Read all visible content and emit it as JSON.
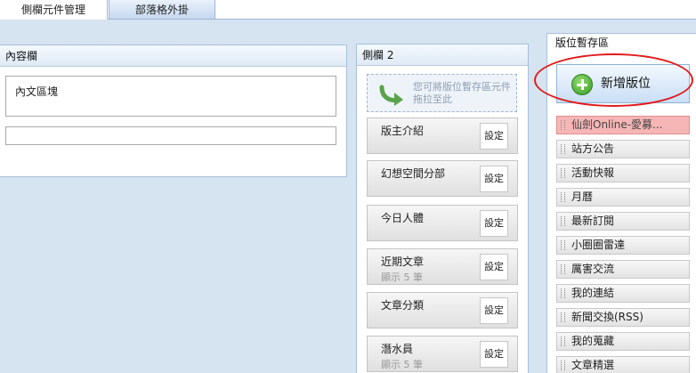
{
  "tabs": [
    {
      "label": "側欄元件管理",
      "active": true
    },
    {
      "label": "部落格外掛",
      "active": false
    }
  ],
  "content_panel": {
    "title": "內容欄",
    "text_block": "內文區塊",
    "text_field_value": ""
  },
  "sidebar2": {
    "title": "側欄 2",
    "drop_hint": "您可將版位暫存區元件拖拉至此",
    "settings_label": "設定",
    "widgets": [
      {
        "title": "版主介紹",
        "subtitle": ""
      },
      {
        "title": "幻想空間分部",
        "subtitle": ""
      },
      {
        "title": "今日人體",
        "subtitle": ""
      },
      {
        "title": "近期文章",
        "subtitle": "顯示 5 筆"
      },
      {
        "title": "文章分類",
        "subtitle": ""
      },
      {
        "title": "潛水員",
        "subtitle": "顯示 5 筆"
      }
    ]
  },
  "storage": {
    "title": "版位暫存區",
    "add_button_label": "新增版位",
    "items": [
      {
        "label": "仙劍Online-愛募...",
        "highlight": true
      },
      {
        "label": "站方公告"
      },
      {
        "label": "活動快報"
      },
      {
        "label": "月曆"
      },
      {
        "label": "最新訂閱"
      },
      {
        "label": "小圈圈雷達"
      },
      {
        "label": "厲害交流"
      },
      {
        "label": "我的連結"
      },
      {
        "label": "新聞交換(RSS)"
      },
      {
        "label": "我的蒐藏"
      },
      {
        "label": "文章精選"
      }
    ]
  },
  "colors": {
    "accent_ring": "#e01b1b",
    "highlight_item": "#f6b6b6",
    "page_background": "#d6e3f1"
  },
  "icons": {
    "add": "plus-circle-icon",
    "drop": "curved-arrow-icon",
    "drag": "drag-handle-icon"
  }
}
